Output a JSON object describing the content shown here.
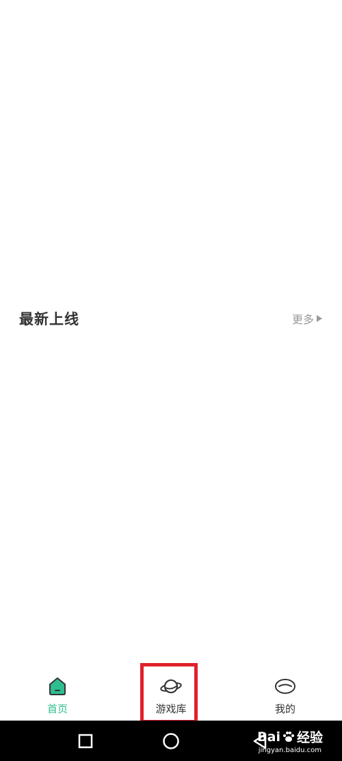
{
  "section": {
    "title": "最新上线",
    "more_label": "更多"
  },
  "tabs": [
    {
      "label": "首页",
      "icon": "home-icon",
      "active": true
    },
    {
      "label": "游戏库",
      "icon": "planet-icon",
      "active": false
    },
    {
      "label": "我的",
      "icon": "face-icon",
      "active": false
    }
  ],
  "watermark": {
    "brand": "Bai",
    "brand_suffix": "经验",
    "url": "jingyan.baidu.com"
  },
  "colors": {
    "accent": "#2dbd8f",
    "highlight": "#e0202a",
    "text": "#333333",
    "muted": "#999999"
  }
}
